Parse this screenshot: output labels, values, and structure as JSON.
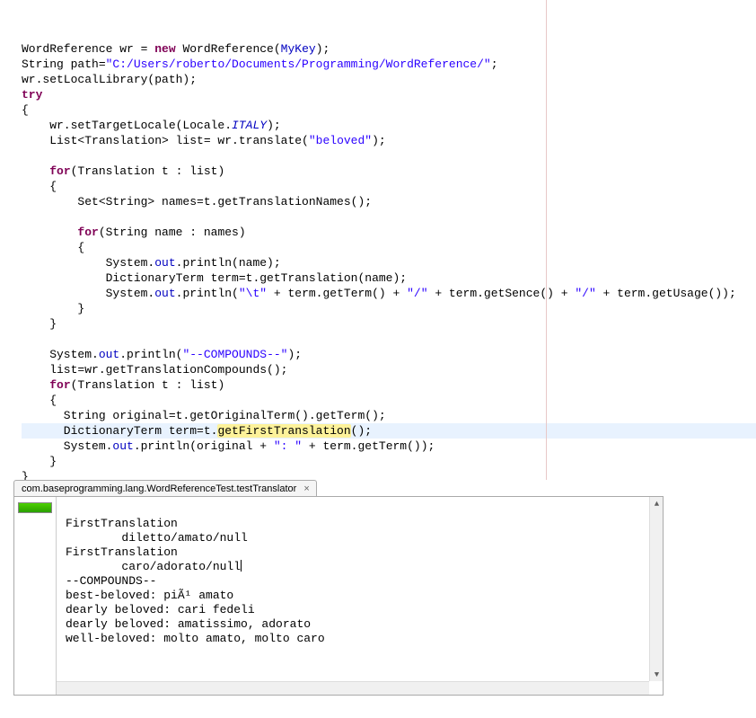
{
  "code": {
    "kw_new": "new",
    "kw_try": "try",
    "kw_for1": "for",
    "kw_for2": "for",
    "kw_for3": "for",
    "var_MyKey": "MyKey",
    "str_path": "\"C:/Users/roberto/Documents/Programming/WordReference/\"",
    "const_ITALY": "ITALY",
    "str_beloved": "\"beloved\"",
    "fld_out1": "out",
    "fld_out2": "out",
    "fld_out3": "out",
    "fld_out4": "out",
    "str_tab": "\"\\t\"",
    "str_slash1": "\"/\"",
    "str_slash2": "\"/\"",
    "str_compounds": "\"--COMPOUNDS--\"",
    "hl_method": "getFirstTranslation",
    "str_colon": "\": \"",
    "l1a": "WordReference wr = ",
    "l1b": " WordReference(",
    "l1c": ");",
    "l2a": "String path=",
    "l2b": ";",
    "l3": "wr.setLocalLibrary(path);",
    "l5": "{",
    "l6a": "    wr.setTargetLocale(Locale.",
    "l6b": ");",
    "l7a": "    List<Translation> list= wr.translate(",
    "l7b": ");",
    "l9a": "    ",
    "l9b": "(Translation t : list)",
    "l10": "    {",
    "l11": "        Set<String> names=t.getTranslationNames();",
    "l13a": "        ",
    "l13b": "(String name : names)",
    "l14": "        {",
    "l15a": "            System.",
    "l15b": ".println(name);",
    "l16": "            DictionaryTerm term=t.getTranslation(name);",
    "l17a": "            System.",
    "l17b": ".println(",
    "l17c": " + term.getTerm() + ",
    "l17d": " + term.getSence() + ",
    "l17e": " + term.getUsage());",
    "l18": "        }",
    "l19": "    }",
    "l21a": "    System.",
    "l21b": ".println(",
    "l21c": ");",
    "l22": "    list=wr.getTranslationCompounds();",
    "l23a": "    ",
    "l23b": "(Translation t : list)",
    "l24": "    {",
    "l25": "      String original=t.getOriginalTerm().getTerm();",
    "l26a": "      DictionaryTerm term=t.",
    "l26b": "();",
    "l27a": "      System.",
    "l27b": ".println(original + ",
    "l27c": " + term.getTerm());",
    "l28": "    }",
    "l29": "}"
  },
  "tab": {
    "label": "com.baseprogramming.lang.WordReferenceTest.testTranslator"
  },
  "console": {
    "lines": [
      "FirstTranslation",
      "        diletto/amato/null",
      "FirstTranslation",
      "        caro/adorato/null",
      "--COMPOUNDS--",
      "best-beloved: piÃ¹ amato",
      "dearly beloved: cari fedeli",
      "dearly beloved: amatissimo, adorato",
      "well-beloved: molto amato, molto caro"
    ]
  }
}
